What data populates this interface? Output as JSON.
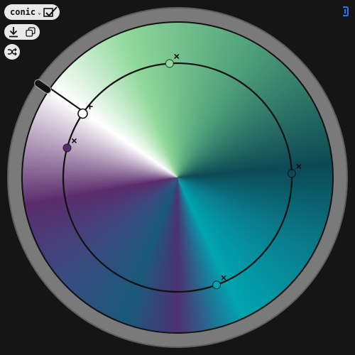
{
  "toolbar": {
    "mode_value": "conic",
    "mode_caret": "⌄",
    "check_icon": "check-icon",
    "download_icon": "download-icon",
    "copy_icon": "copy-icon",
    "shuffle_icon": "shuffle-icon"
  },
  "corner_icon": "power-toggle-icon",
  "colors": {
    "background": "#151515",
    "ring_outer": "#5f5f5f",
    "ring_inner": "#7a7a7a",
    "accent_blue": "#1e78ff",
    "stops": [
      "#4c3270",
      "#5b2c6d",
      "#ffffff",
      "#8fd89a",
      "#4fa07a",
      "#0c4a55",
      "#0a7e8f",
      "#00a5b0",
      "#1a5a7a",
      "#3b4a80"
    ]
  },
  "handles": [
    {
      "name": "handle-white",
      "angle_deg": 304,
      "radius_frac": 0.84,
      "color": "#ffffff",
      "removable": false,
      "selected": true
    },
    {
      "name": "handle-green",
      "angle_deg": 356,
      "radius_frac": 0.84,
      "color": "#8fd89a",
      "removable": true
    },
    {
      "name": "handle-teal-dark",
      "angle_deg": 88,
      "radius_frac": 0.84,
      "color": "#0c4a55",
      "removable": true
    },
    {
      "name": "handle-cyan",
      "angle_deg": 160,
      "radius_frac": 0.84,
      "color": "#00a5b0",
      "removable": true
    },
    {
      "name": "handle-purple",
      "angle_deg": 285,
      "radius_frac": 0.84,
      "color": "#5b2c6d",
      "removable": true
    }
  ],
  "rotation_handle_angle_deg": 305
}
